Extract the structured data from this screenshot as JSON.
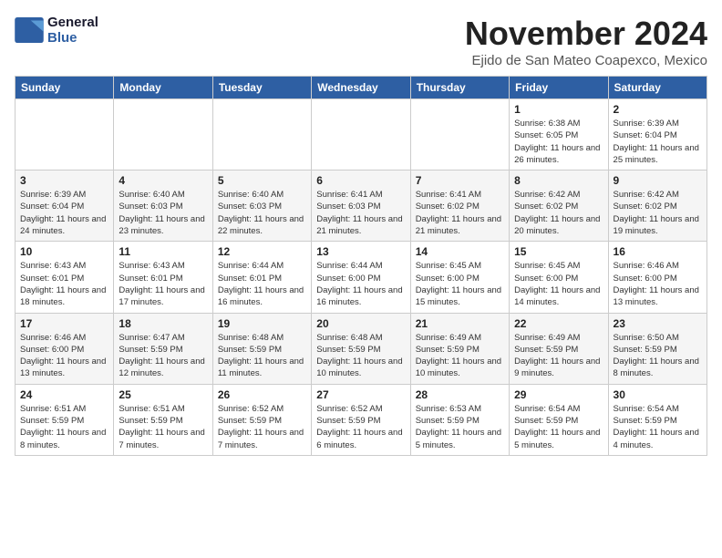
{
  "logo": {
    "line1": "General",
    "line2": "Blue"
  },
  "title": "November 2024",
  "location": "Ejido de San Mateo Coapexco, Mexico",
  "weekdays": [
    "Sunday",
    "Monday",
    "Tuesday",
    "Wednesday",
    "Thursday",
    "Friday",
    "Saturday"
  ],
  "weeks": [
    [
      {
        "day": "",
        "info": ""
      },
      {
        "day": "",
        "info": ""
      },
      {
        "day": "",
        "info": ""
      },
      {
        "day": "",
        "info": ""
      },
      {
        "day": "",
        "info": ""
      },
      {
        "day": "1",
        "info": "Sunrise: 6:38 AM\nSunset: 6:05 PM\nDaylight: 11 hours\nand 26 minutes."
      },
      {
        "day": "2",
        "info": "Sunrise: 6:39 AM\nSunset: 6:04 PM\nDaylight: 11 hours\nand 25 minutes."
      }
    ],
    [
      {
        "day": "3",
        "info": "Sunrise: 6:39 AM\nSunset: 6:04 PM\nDaylight: 11 hours\nand 24 minutes."
      },
      {
        "day": "4",
        "info": "Sunrise: 6:40 AM\nSunset: 6:03 PM\nDaylight: 11 hours\nand 23 minutes."
      },
      {
        "day": "5",
        "info": "Sunrise: 6:40 AM\nSunset: 6:03 PM\nDaylight: 11 hours\nand 22 minutes."
      },
      {
        "day": "6",
        "info": "Sunrise: 6:41 AM\nSunset: 6:03 PM\nDaylight: 11 hours\nand 21 minutes."
      },
      {
        "day": "7",
        "info": "Sunrise: 6:41 AM\nSunset: 6:02 PM\nDaylight: 11 hours\nand 21 minutes."
      },
      {
        "day": "8",
        "info": "Sunrise: 6:42 AM\nSunset: 6:02 PM\nDaylight: 11 hours\nand 20 minutes."
      },
      {
        "day": "9",
        "info": "Sunrise: 6:42 AM\nSunset: 6:02 PM\nDaylight: 11 hours\nand 19 minutes."
      }
    ],
    [
      {
        "day": "10",
        "info": "Sunrise: 6:43 AM\nSunset: 6:01 PM\nDaylight: 11 hours\nand 18 minutes."
      },
      {
        "day": "11",
        "info": "Sunrise: 6:43 AM\nSunset: 6:01 PM\nDaylight: 11 hours\nand 17 minutes."
      },
      {
        "day": "12",
        "info": "Sunrise: 6:44 AM\nSunset: 6:01 PM\nDaylight: 11 hours\nand 16 minutes."
      },
      {
        "day": "13",
        "info": "Sunrise: 6:44 AM\nSunset: 6:00 PM\nDaylight: 11 hours\nand 16 minutes."
      },
      {
        "day": "14",
        "info": "Sunrise: 6:45 AM\nSunset: 6:00 PM\nDaylight: 11 hours\nand 15 minutes."
      },
      {
        "day": "15",
        "info": "Sunrise: 6:45 AM\nSunset: 6:00 PM\nDaylight: 11 hours\nand 14 minutes."
      },
      {
        "day": "16",
        "info": "Sunrise: 6:46 AM\nSunset: 6:00 PM\nDaylight: 11 hours\nand 13 minutes."
      }
    ],
    [
      {
        "day": "17",
        "info": "Sunrise: 6:46 AM\nSunset: 6:00 PM\nDaylight: 11 hours\nand 13 minutes."
      },
      {
        "day": "18",
        "info": "Sunrise: 6:47 AM\nSunset: 5:59 PM\nDaylight: 11 hours\nand 12 minutes."
      },
      {
        "day": "19",
        "info": "Sunrise: 6:48 AM\nSunset: 5:59 PM\nDaylight: 11 hours\nand 11 minutes."
      },
      {
        "day": "20",
        "info": "Sunrise: 6:48 AM\nSunset: 5:59 PM\nDaylight: 11 hours\nand 10 minutes."
      },
      {
        "day": "21",
        "info": "Sunrise: 6:49 AM\nSunset: 5:59 PM\nDaylight: 11 hours\nand 10 minutes."
      },
      {
        "day": "22",
        "info": "Sunrise: 6:49 AM\nSunset: 5:59 PM\nDaylight: 11 hours\nand 9 minutes."
      },
      {
        "day": "23",
        "info": "Sunrise: 6:50 AM\nSunset: 5:59 PM\nDaylight: 11 hours\nand 8 minutes."
      }
    ],
    [
      {
        "day": "24",
        "info": "Sunrise: 6:51 AM\nSunset: 5:59 PM\nDaylight: 11 hours\nand 8 minutes."
      },
      {
        "day": "25",
        "info": "Sunrise: 6:51 AM\nSunset: 5:59 PM\nDaylight: 11 hours\nand 7 minutes."
      },
      {
        "day": "26",
        "info": "Sunrise: 6:52 AM\nSunset: 5:59 PM\nDaylight: 11 hours\nand 7 minutes."
      },
      {
        "day": "27",
        "info": "Sunrise: 6:52 AM\nSunset: 5:59 PM\nDaylight: 11 hours\nand 6 minutes."
      },
      {
        "day": "28",
        "info": "Sunrise: 6:53 AM\nSunset: 5:59 PM\nDaylight: 11 hours\nand 5 minutes."
      },
      {
        "day": "29",
        "info": "Sunrise: 6:54 AM\nSunset: 5:59 PM\nDaylight: 11 hours\nand 5 minutes."
      },
      {
        "day": "30",
        "info": "Sunrise: 6:54 AM\nSunset: 5:59 PM\nDaylight: 11 hours\nand 4 minutes."
      }
    ]
  ]
}
